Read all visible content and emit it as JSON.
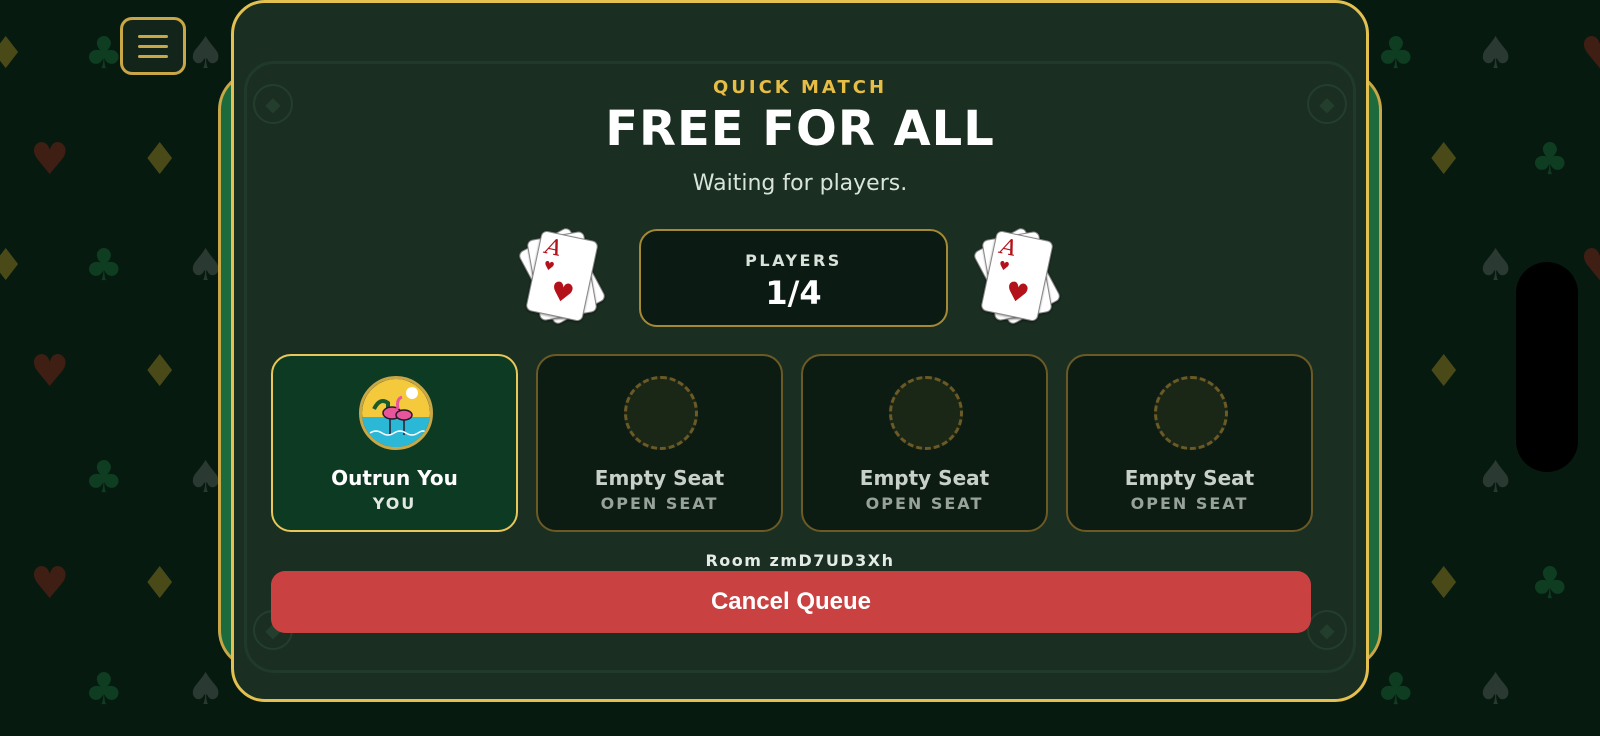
{
  "colors": {
    "background": "#071a10",
    "panel": "#1a2e22",
    "gold_border": "#e3c04f",
    "accent_text": "#e7bd45",
    "cancel_button": "#c94141",
    "you_seat": "#0c3a23"
  },
  "menu": {
    "icon": "hamburger-menu-icon"
  },
  "header": {
    "subtitle": "QUICK MATCH",
    "title": "FREE FOR ALL",
    "status": "Waiting for players."
  },
  "players": {
    "label": "PLAYERS",
    "count": "1/4"
  },
  "decor": {
    "card_rank": "A",
    "card_suit": "♥",
    "card_icon": "ace-of-hearts-fan-icon"
  },
  "seats": [
    {
      "name": "Outrun You",
      "sub": "YOU",
      "avatar": "flamingo-avatar-icon"
    },
    {
      "name": "Empty Seat",
      "sub": "OPEN SEAT",
      "avatar": "empty-seat-icon"
    },
    {
      "name": "Empty Seat",
      "sub": "OPEN SEAT",
      "avatar": "empty-seat-icon"
    },
    {
      "name": "Empty Seat",
      "sub": "OPEN SEAT",
      "avatar": "empty-seat-icon"
    }
  ],
  "room": {
    "label": "Room zmD7UD3Xh"
  },
  "actions": {
    "cancel_label": "Cancel Queue"
  }
}
